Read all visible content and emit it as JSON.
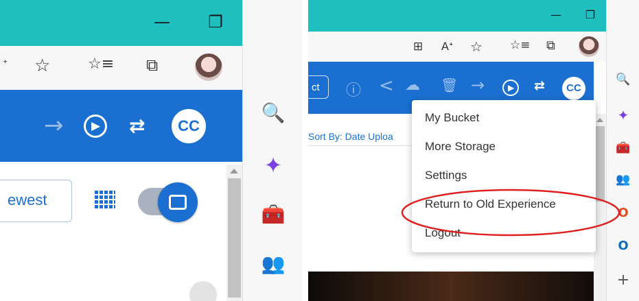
{
  "left": {
    "window": {
      "minimize": "—",
      "restore": "❐",
      "close": "✕"
    },
    "toolbar": {
      "read_aloud_fragment": "ᐩ",
      "favorite_add": "☆",
      "favorites": "☆≡",
      "collections": "⧉",
      "more": "···"
    },
    "bluebar": {
      "forward": "→",
      "play": "▶",
      "link": "⇄",
      "cc_label": "CC"
    },
    "sort_button_text": "ewest",
    "grid_icon": "▦",
    "sidebar": {
      "search": "🔍",
      "copilot": "✦",
      "tools": "🧰",
      "games": "👥"
    }
  },
  "right": {
    "window": {
      "minimize": "—",
      "restore": "❐",
      "close": "✕"
    },
    "toolbar": {
      "split": "⊞",
      "read_aloud": "Aᐩ",
      "favorite_add": "☆",
      "favorites": "☆≡",
      "collections": "⧉",
      "more": "···"
    },
    "bluebar": {
      "select_fragment": "ct",
      "info": "ⓘ",
      "share": "<",
      "upload": "☁",
      "delete": "🗑",
      "forward": "→",
      "play": "▶",
      "link": "⇄",
      "cc_label": "CC"
    },
    "sort_text": "Sort By: Date Uploa",
    "sidebar": {
      "search": "🔍",
      "copilot": "✦",
      "tools": "🧰",
      "games": "👥",
      "office": "O",
      "outlook": "O",
      "add": "+"
    },
    "menu": {
      "items": [
        {
          "label": "My Bucket"
        },
        {
          "label": "More Storage"
        },
        {
          "label": "Settings"
        },
        {
          "label": "Return to Old Experience"
        },
        {
          "label": "Logout"
        }
      ]
    }
  },
  "colors": {
    "titlebar": "#1fbfc0",
    "brand_blue": "#1a6fd0",
    "highlight_red": "#e02020",
    "toolbar_bg": "#f7f7f7"
  }
}
